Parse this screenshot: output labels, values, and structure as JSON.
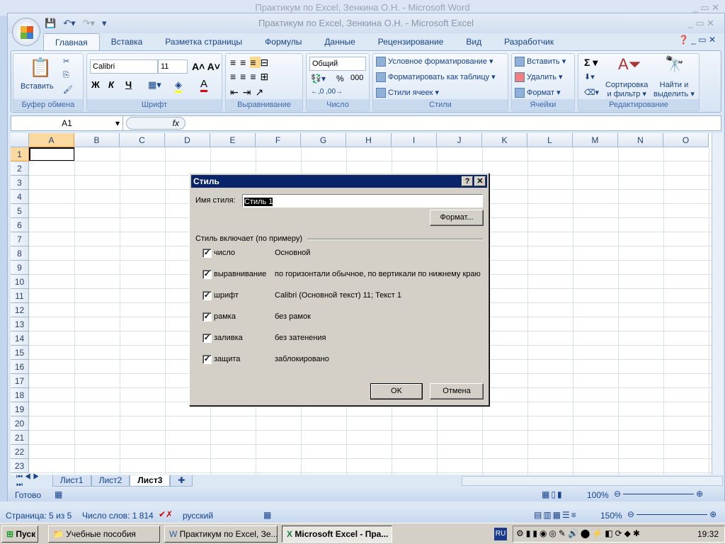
{
  "word": {
    "title": "Практикум по Excel, Зенкина О.Н. - Microsoft Word",
    "status": {
      "page": "Страница: 5 из 5",
      "words": "Число слов: 1 814",
      "language": "русский",
      "zoom": "150%"
    }
  },
  "excel": {
    "title": "Практикум по Excel, Зенкина О.Н. - Microsoft Excel",
    "tabs": [
      "Главная",
      "Вставка",
      "Разметка страницы",
      "Формулы",
      "Данные",
      "Рецензирование",
      "Вид",
      "Разработчик"
    ],
    "ribbon": {
      "clipboard": {
        "label": "Буфер обмена",
        "paste": "Вставить"
      },
      "font": {
        "label": "Шрифт",
        "name": "Calibri",
        "size": "11",
        "bold": "Ж",
        "italic": "К",
        "underline": "Ч"
      },
      "alignment": {
        "label": "Выравнивание"
      },
      "number": {
        "label": "Число",
        "format": "Общий",
        "percent": "%",
        "thousands": "000"
      },
      "styles": {
        "label": "Стили",
        "conditional": "Условное форматирование",
        "as_table": "Форматировать как таблицу",
        "cell_styles": "Стили ячеек"
      },
      "cells": {
        "label": "Ячейки",
        "insert": "Вставить",
        "delete": "Удалить",
        "format": "Формат"
      },
      "editing": {
        "label": "Редактирование",
        "sum": "Σ",
        "sort1": "Сортировка",
        "sort2": "и фильтр",
        "find1": "Найти и",
        "find2": "выделить"
      }
    },
    "namebox": "A1",
    "fx": "fx",
    "columns": [
      "A",
      "B",
      "C",
      "D",
      "E",
      "F",
      "G",
      "H",
      "I",
      "J",
      "K",
      "L",
      "M",
      "N",
      "O"
    ],
    "rows": [
      "1",
      "2",
      "3",
      "4",
      "5",
      "6",
      "7",
      "8",
      "9",
      "10",
      "11",
      "12",
      "13",
      "14",
      "15",
      "16",
      "17",
      "18",
      "19",
      "20",
      "21",
      "22",
      "23"
    ],
    "sheets": [
      "Лист1",
      "Лист2",
      "Лист3"
    ],
    "status": "Готово",
    "zoom": "100%"
  },
  "dialog": {
    "title": "Стиль",
    "name_label": "Имя стиля:",
    "name_value": "Стиль 1",
    "format_button": "Формат...",
    "group_label": "Стиль включает (по примеру)",
    "items": [
      {
        "label": "число",
        "value": "Основной",
        "checked": true
      },
      {
        "label": "выравнивание",
        "value": "по горизонтали обычное, по вертикали по нижнему краю",
        "checked": true
      },
      {
        "label": "шрифт",
        "value": "Calibri (Основной текст) 11; Текст 1",
        "checked": true
      },
      {
        "label": "рамка",
        "value": "без рамок",
        "checked": true
      },
      {
        "label": "заливка",
        "value": "без затенения",
        "checked": true
      },
      {
        "label": "защита",
        "value": "заблокировано",
        "checked": true
      }
    ],
    "ok": "OK",
    "cancel": "Отмена"
  },
  "taskbar": {
    "start": "Пуск",
    "items": [
      "Учебные пособия",
      "Практикум по Excel, Зе...",
      "Microsoft Excel - Пра..."
    ],
    "lang": "RU",
    "clock": "19:32"
  }
}
